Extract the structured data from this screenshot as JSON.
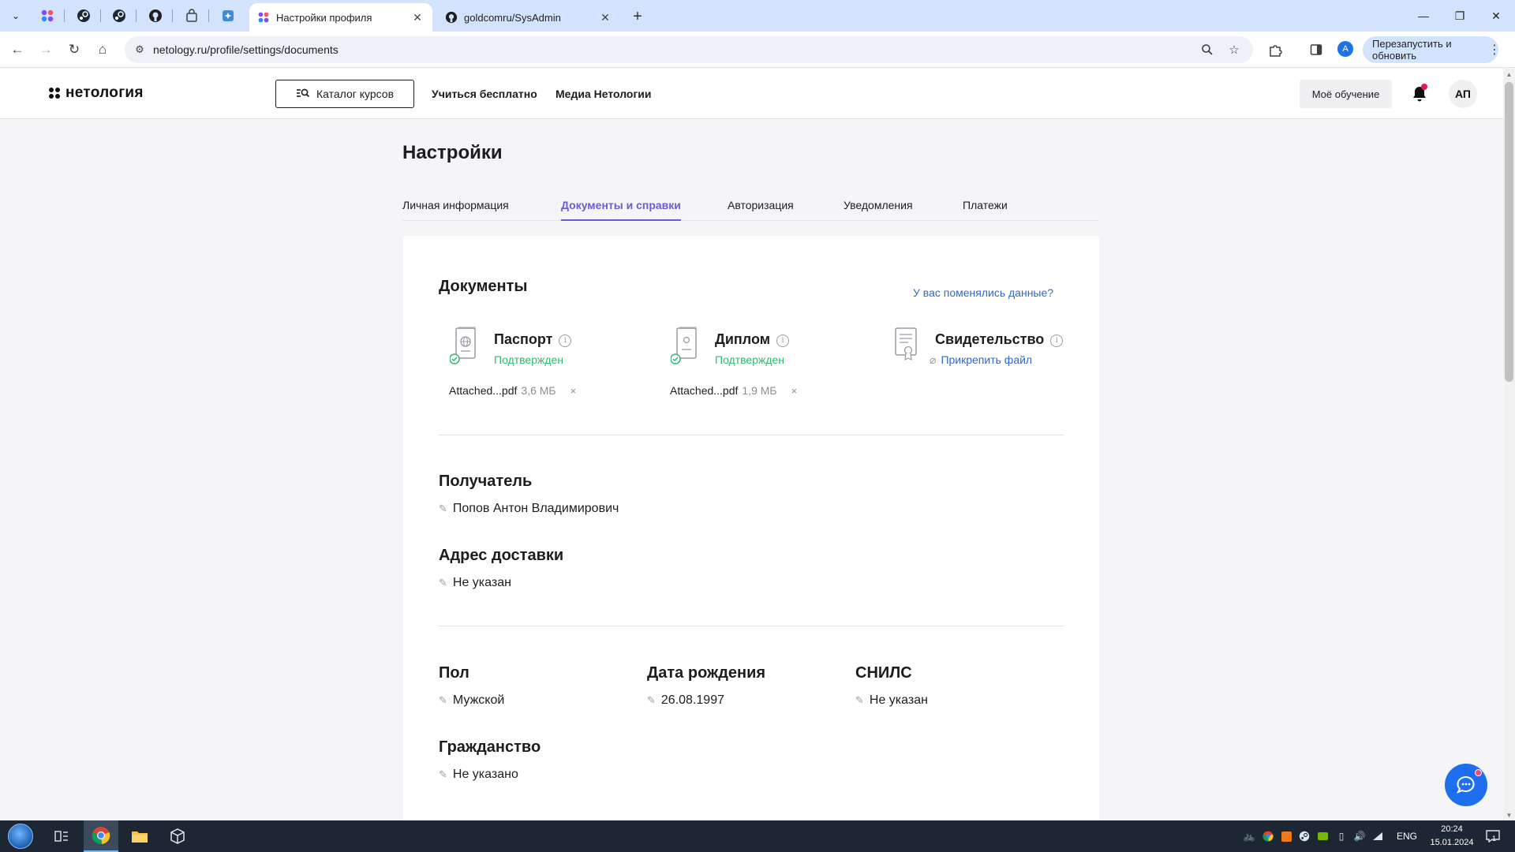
{
  "browser": {
    "tabs": [
      {
        "title": "Настройки профиля",
        "active": true
      },
      {
        "title": "goldcomru/SysAdmin",
        "active": false
      }
    ],
    "new_tab": "+",
    "url": "netology.ru/profile/settings/documents",
    "profile_initial": "A",
    "restart_label": "Перезапустить и обновить"
  },
  "header": {
    "logo_text": "нетология",
    "catalog_label": "Каталог курсов",
    "links": [
      "Учиться бесплатно",
      "Медиа Нетологии"
    ],
    "my_learning_label": "Моё обучение",
    "avatar_initials": "АП"
  },
  "page": {
    "title": "Настройки",
    "tabs": [
      {
        "label": "Личная информация",
        "active": false
      },
      {
        "label": "Документы и справки",
        "active": true
      },
      {
        "label": "Авторизация",
        "active": false
      },
      {
        "label": "Уведомления",
        "active": false
      },
      {
        "label": "Платежи",
        "active": false
      }
    ]
  },
  "documents": {
    "title": "Документы",
    "changed_link": "У вас поменялись данные?",
    "items": [
      {
        "name": "Паспорт",
        "status": "Подтвержден",
        "file_name": "Attached...pdf",
        "file_size": "3,6 МБ",
        "icon": "passport-icon",
        "confirmed": true
      },
      {
        "name": "Диплом",
        "status": "Подтвержден",
        "file_name": "Attached...pdf",
        "file_size": "1,9 МБ",
        "icon": "diploma-icon",
        "confirmed": true
      },
      {
        "name": "Свидетельство",
        "attach_label": "Прикрепить файл",
        "icon": "certificate-icon",
        "confirmed": false
      }
    ],
    "remove_glyph": "×"
  },
  "recipient": {
    "label": "Получатель",
    "value": "Попов Антон Владимирович"
  },
  "delivery": {
    "label": "Адрес доставки",
    "value": "Не указан"
  },
  "gender": {
    "label": "Пол",
    "value": "Мужской"
  },
  "birthdate": {
    "label": "Дата рождения",
    "value": "26.08.1997"
  },
  "snils": {
    "label": "СНИЛС",
    "value": "Не указан"
  },
  "citizenship": {
    "label": "Гражданство",
    "value": "Не указано"
  },
  "taskbar": {
    "language": "ENG",
    "time": "20:24",
    "date": "15.01.2024",
    "notification_count": "1"
  },
  "colors": {
    "accent": "#6e5ad6",
    "link": "#3366cc",
    "confirmed": "#2ebb6e",
    "chat_button": "#1e6ff0"
  }
}
